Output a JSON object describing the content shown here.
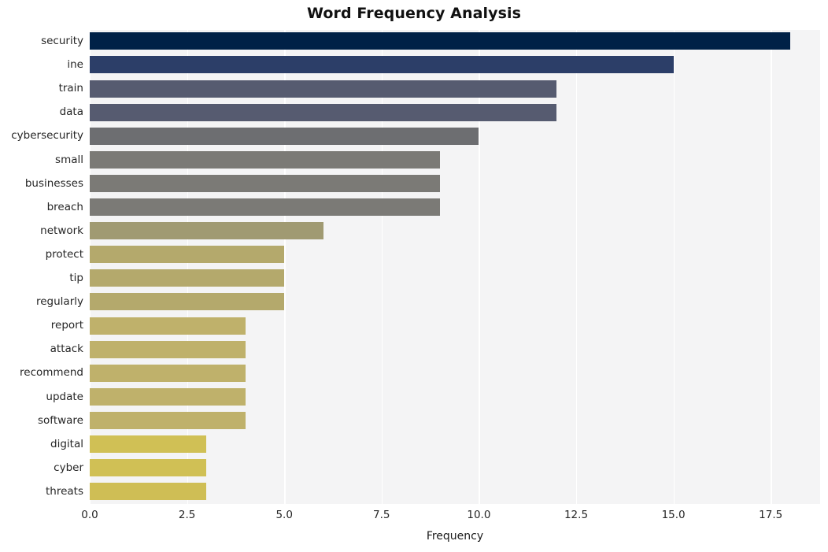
{
  "chart_data": {
    "type": "bar",
    "orientation": "horizontal",
    "title": "Word Frequency Analysis",
    "xlabel": "Frequency",
    "ylabel": "",
    "categories": [
      "security",
      "ine",
      "train",
      "data",
      "cybersecurity",
      "small",
      "businesses",
      "breach",
      "network",
      "protect",
      "tip",
      "regularly",
      "report",
      "attack",
      "recommend",
      "update",
      "software",
      "digital",
      "cyber",
      "threats"
    ],
    "values": [
      18,
      15,
      12,
      12,
      10,
      9,
      9,
      9,
      6,
      5,
      5,
      5,
      4,
      4,
      4,
      4,
      4,
      3,
      3,
      3
    ],
    "bar_colors": [
      "#002147",
      "#2c3e68",
      "#565b70",
      "#565b70",
      "#6d6e71",
      "#7b7a76",
      "#7b7a76",
      "#7b7a76",
      "#a09a72",
      "#b4a96c",
      "#b4a96c",
      "#b4a96c",
      "#bfb16b",
      "#bfb16b",
      "#bfb16b",
      "#bfb16b",
      "#bfb16b",
      "#d0c055",
      "#d0c055",
      "#cfbe55"
    ],
    "xlim": [
      0,
      18.77
    ],
    "xticks": [
      0,
      2.5,
      5,
      7.5,
      10,
      12.5,
      15,
      17.5
    ],
    "xtick_labels": [
      "0.0",
      "2.5",
      "5.0",
      "7.5",
      "10.0",
      "12.5",
      "15.0",
      "17.5"
    ],
    "grid": "vertical-only",
    "legend": "none",
    "plot_background": "#f4f4f5",
    "gridline_color": "#ffffff",
    "figure_background": "#ffffff"
  }
}
